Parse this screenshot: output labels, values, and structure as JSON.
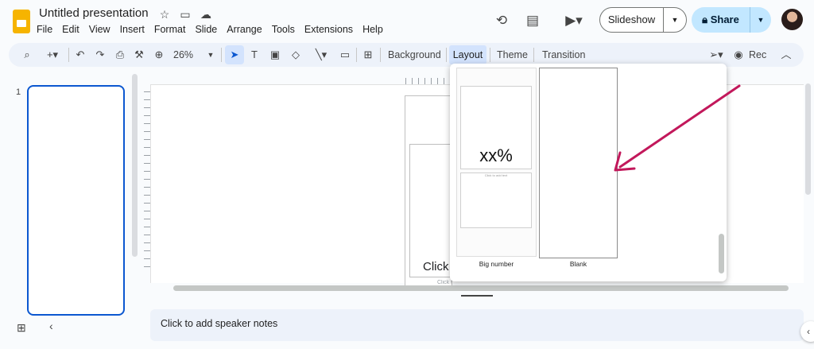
{
  "app": {
    "title": "Untitled presentation",
    "menu": [
      "File",
      "Edit",
      "View",
      "Insert",
      "Format",
      "Slide",
      "Arrange",
      "Tools",
      "Extensions",
      "Help"
    ],
    "slideshow_label": "Slideshow",
    "share_label": "Share"
  },
  "toolbar": {
    "zoom": "26%",
    "background_label": "Background",
    "layout_label": "Layout",
    "theme_label": "Theme",
    "transition_label": "Transition",
    "rec_label": "Rec"
  },
  "filmstrip": {
    "slide_number": "1"
  },
  "slide": {
    "title_placeholder": "Click",
    "subtitle_placeholder": "Click to add subtitle"
  },
  "layout_menu": {
    "items": [
      {
        "label": "Big number",
        "big_text": "xx%",
        "small_text": "Click to add text"
      },
      {
        "label": "Blank"
      }
    ]
  },
  "notes": {
    "placeholder": "Click to add speaker notes"
  },
  "colors": {
    "accent": "#0b57d0",
    "annotation_arrow": "#c2185b",
    "logo": "#f6b400"
  }
}
